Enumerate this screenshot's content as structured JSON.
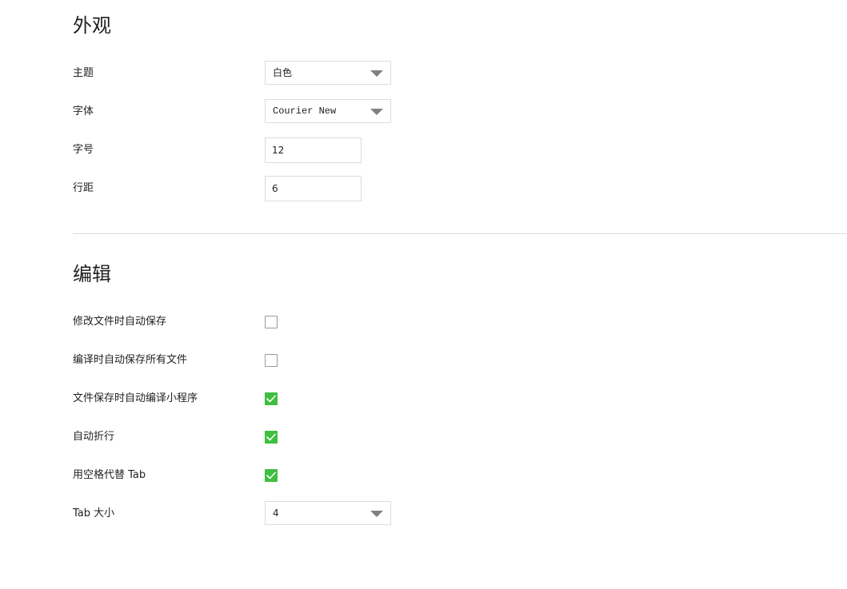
{
  "appearance": {
    "title": "外观",
    "theme": {
      "label": "主题",
      "value": "白色"
    },
    "font": {
      "label": "字体",
      "value": "Courier New"
    },
    "font_size": {
      "label": "字号",
      "value": "12"
    },
    "line_spacing": {
      "label": "行距",
      "value": "6"
    }
  },
  "editing": {
    "title": "编辑",
    "auto_save_on_modify": {
      "label": "修改文件时自动保存",
      "checked": false
    },
    "auto_save_all_on_compile": {
      "label": "编译时自动保存所有文件",
      "checked": false
    },
    "auto_compile_on_save": {
      "label": "文件保存时自动编译小程序",
      "checked": true
    },
    "word_wrap": {
      "label": "自动折行",
      "checked": true
    },
    "spaces_for_tab": {
      "label": "用空格代替 Tab",
      "checked": true
    },
    "tab_size": {
      "label": "Tab 大小",
      "value": "4"
    }
  },
  "colors": {
    "checkbox_checked": "#3fbf3f",
    "border": "#dcdcdc",
    "caret": "#808080"
  },
  "icons": {
    "dropdown": "chevron-down-icon",
    "checkmark": "checkmark-icon"
  }
}
